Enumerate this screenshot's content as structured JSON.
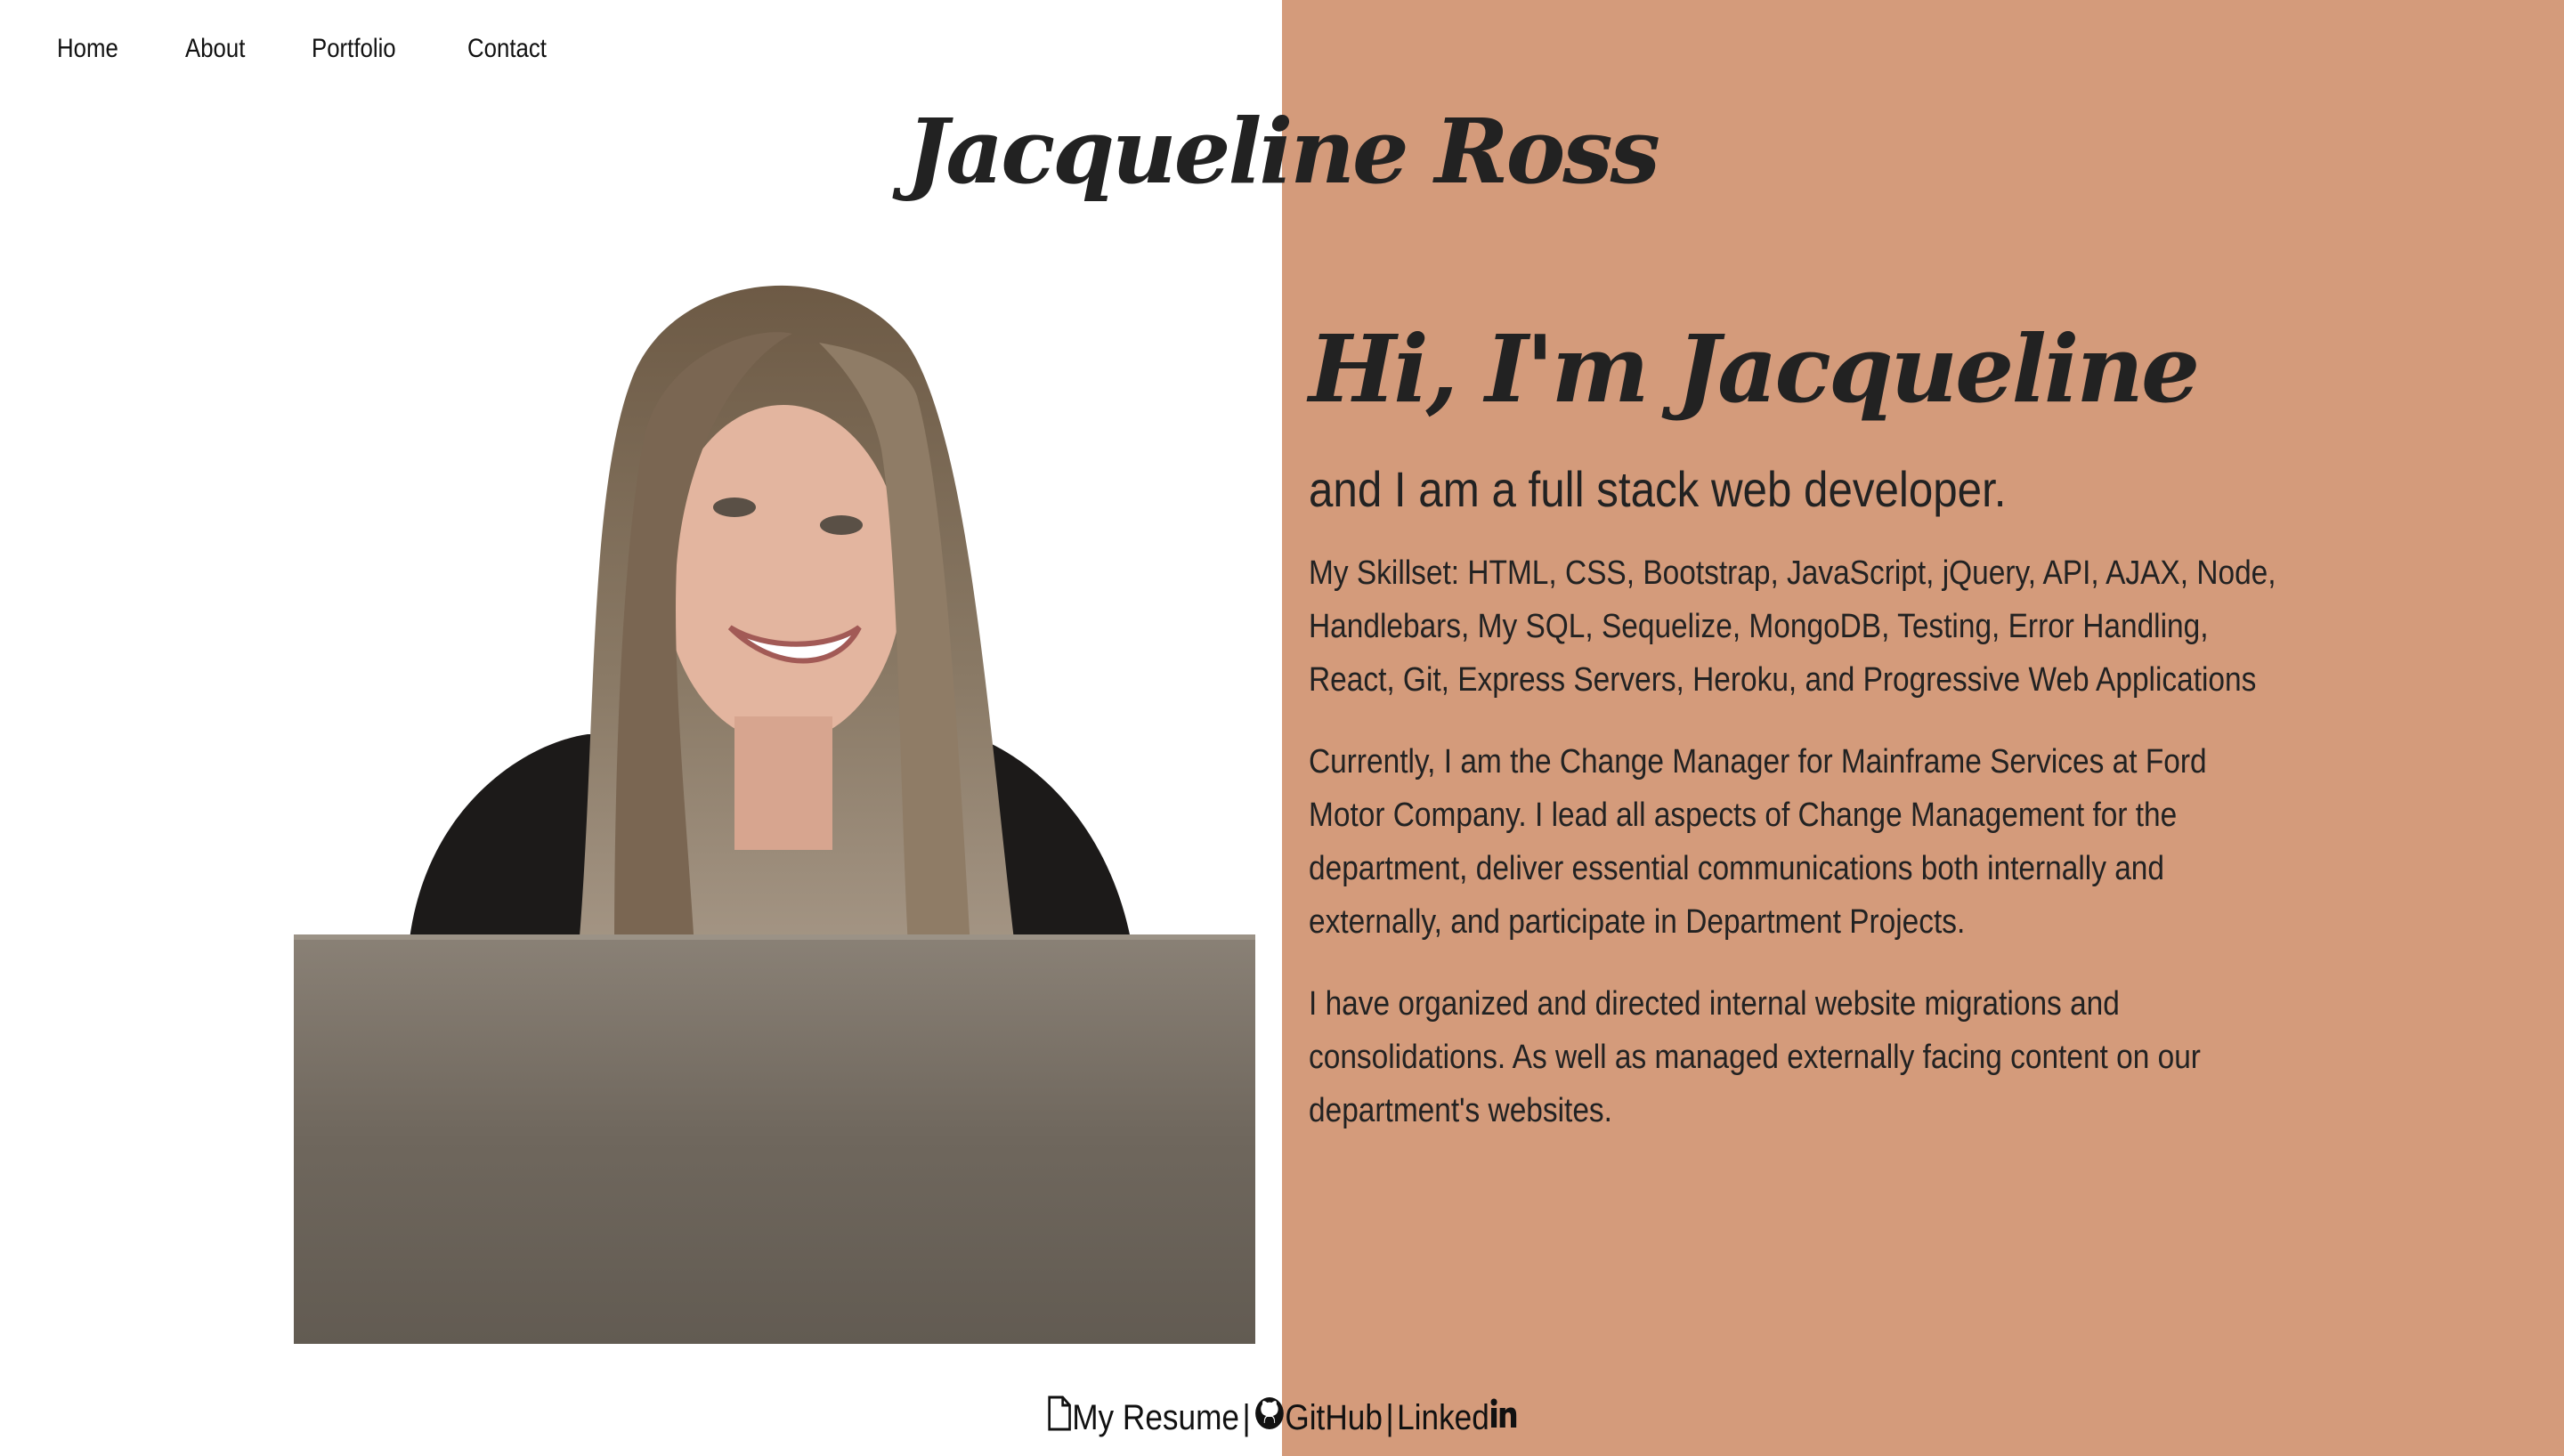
{
  "nav": {
    "items": [
      {
        "label": "Home"
      },
      {
        "label": "About"
      },
      {
        "label": "Portfolio"
      },
      {
        "label": "Contact"
      }
    ]
  },
  "header": {
    "title": "Jacqueline Ross"
  },
  "about": {
    "greeting": "Hi, I'm Jacqueline",
    "tagline": "and I am a full stack web developer.",
    "skills": "My Skillset: HTML, CSS, Bootstrap, JavaScript, jQuery, API, AJAX, Node, Handlebars, My SQL, Sequelize, MongoDB, Testing, Error Handling, React, Git, Express Servers, Heroku, and Progressive Web Applications",
    "current_role": "Currently, I am the Change Manager for Mainframe Services at Ford Motor Company. I lead all aspects of Change Management for the department, deliver essential communications both internally and externally, and participate in Department Projects.",
    "experience": "I have organized and directed internal website migrations and consolidations. As well as managed externally facing content on our department's websites."
  },
  "footer": {
    "resume_label": "My Resume",
    "github_label": "GitHub",
    "linkedin_label": "Linked",
    "separator": "|",
    "icons": [
      "file-icon",
      "github-icon",
      "linkedin-icon"
    ]
  },
  "colors": {
    "accent_panel": "#d49b7b",
    "text": "#222222",
    "background": "#ffffff"
  }
}
